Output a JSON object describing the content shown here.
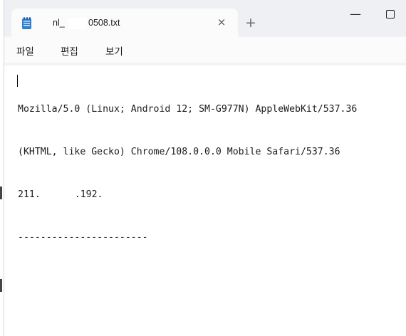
{
  "tab": {
    "title_part1": "nl_",
    "title_part2": "0508.txt",
    "close_glyph": "×",
    "new_tab_glyph": "+",
    "file_icon": "notepad-file-icon"
  },
  "window_controls": {
    "minimize_glyph": "—",
    "maximize_icon": "maximize-icon"
  },
  "menu": {
    "file": "파일",
    "edit": "편집",
    "view": "보기"
  },
  "document": {
    "line1": "Mozilla/5.0 (Linux; Android 12; SM-G977N) AppleWebKit/537.36",
    "line2": "(KHTML, like Gecko) Chrome/108.0.0.0 Mobile Safari/537.36",
    "line3_part1": "211.",
    "line3_part2": ".192.",
    "line4": "-----------------------"
  },
  "colors": {
    "titlebar": "#eef0f3",
    "tab": "#fbfbfb",
    "editor": "#ffffff",
    "icon_blue": "#2f7fd0"
  }
}
